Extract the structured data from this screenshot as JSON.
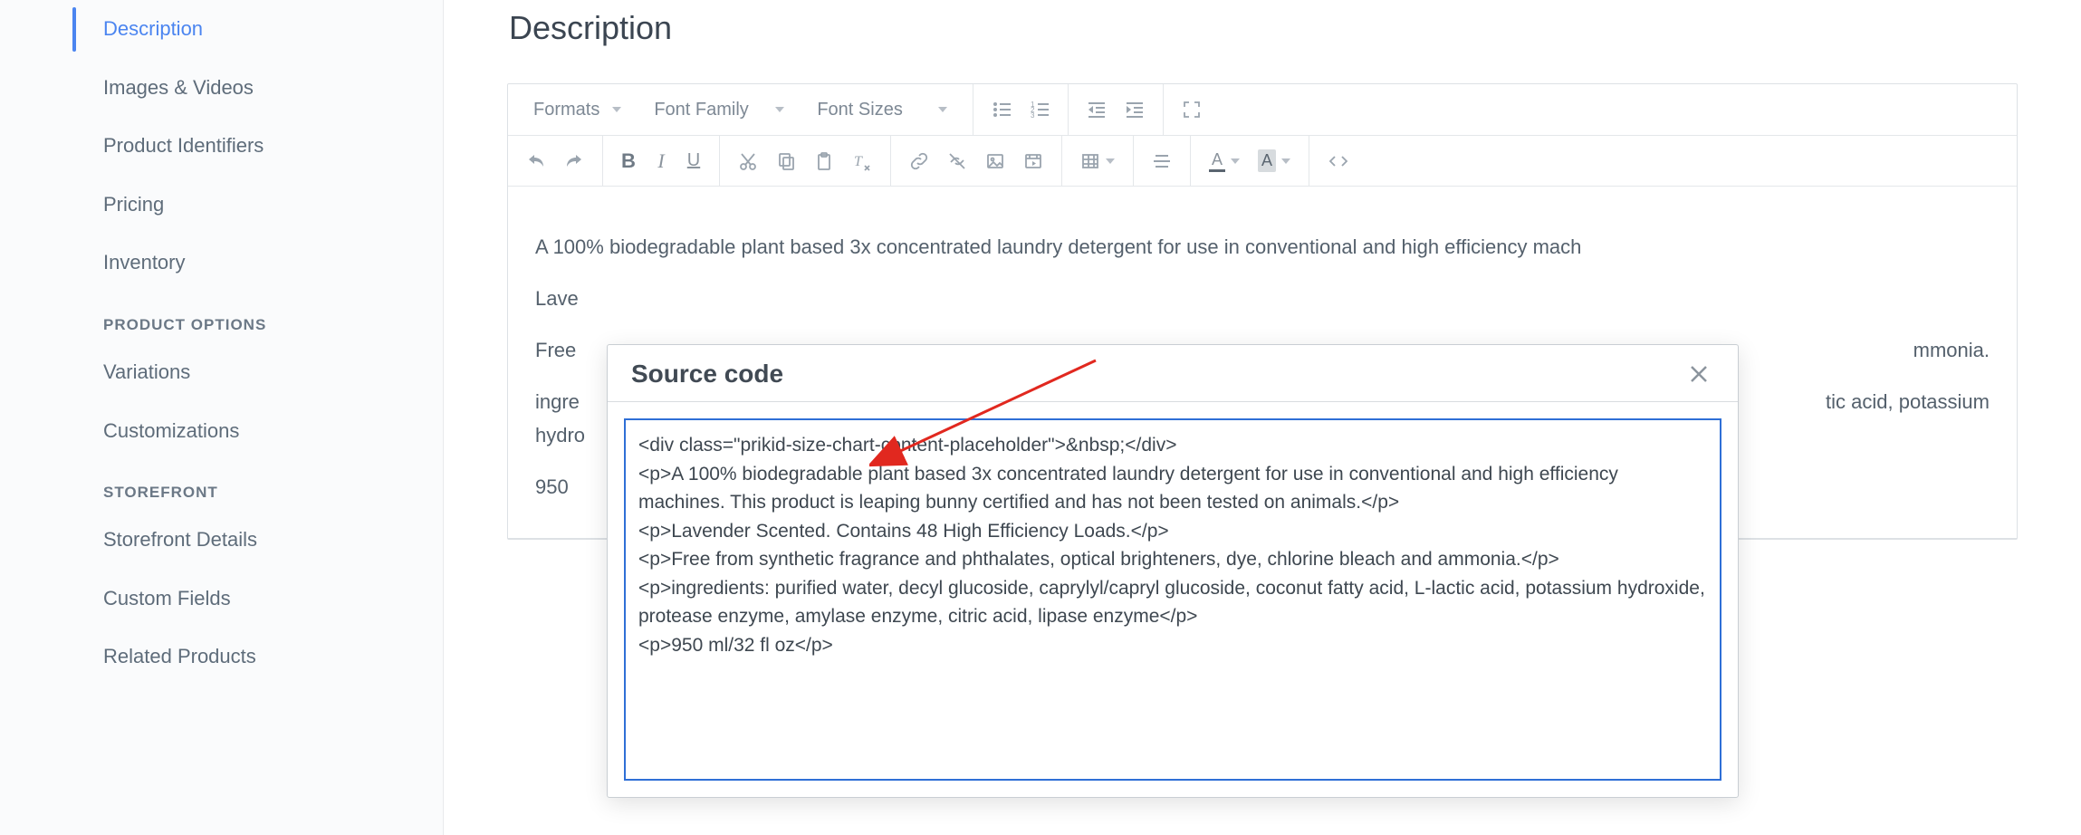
{
  "sidebar": {
    "items": [
      {
        "label": "Description",
        "active": true
      },
      {
        "label": "Images & Videos"
      },
      {
        "label": "Product Identifiers"
      },
      {
        "label": "Pricing"
      },
      {
        "label": "Inventory"
      }
    ],
    "group2_heading": "PRODUCT OPTIONS",
    "group2": [
      {
        "label": "Variations"
      },
      {
        "label": "Customizations"
      }
    ],
    "group3_heading": "STOREFRONT",
    "group3": [
      {
        "label": "Storefront Details"
      },
      {
        "label": "Custom Fields"
      },
      {
        "label": "Related Products"
      }
    ]
  },
  "page": {
    "title": "Description"
  },
  "toolbar": {
    "formats": "Formats",
    "font_family": "Font Family",
    "font_sizes": "Font Sizes"
  },
  "editor": {
    "p1": "A 100% biodegradable plant based 3x concentrated laundry detergent for use in conventional and high efficiency mach",
    "p2_prefix": "Lave",
    "p3_prefix": "Free",
    "p3_suffix": "mmonia.",
    "p4_prefix": "ingre",
    "p4_suffix": "tic acid, potassium",
    "p4b": "hydro",
    "p5": "950 "
  },
  "modal": {
    "title": "Source code",
    "source": "<div class=\"prikid-size-chart-content-placeholder\">&nbsp;</div>\n<p>A 100% biodegradable plant based 3x concentrated laundry detergent for use in conventional and high efficiency machines. This product is leaping bunny certified and has not been tested on animals.</p>\n<p>Lavender Scented. Contains 48 High Efficiency Loads.</p>\n<p>Free from synthetic fragrance and phthalates, optical brighteners, dye, chlorine bleach and ammonia.</p>\n<p>ingredients: purified water, decyl glucoside, caprylyl/capryl glucoside, coconut fatty acid, L-lactic acid, potassium hydroxide, protease enzyme, amylase enzyme, citric acid, lipase enzyme</p>\n<p>950 ml/32 fl oz</p>"
  }
}
